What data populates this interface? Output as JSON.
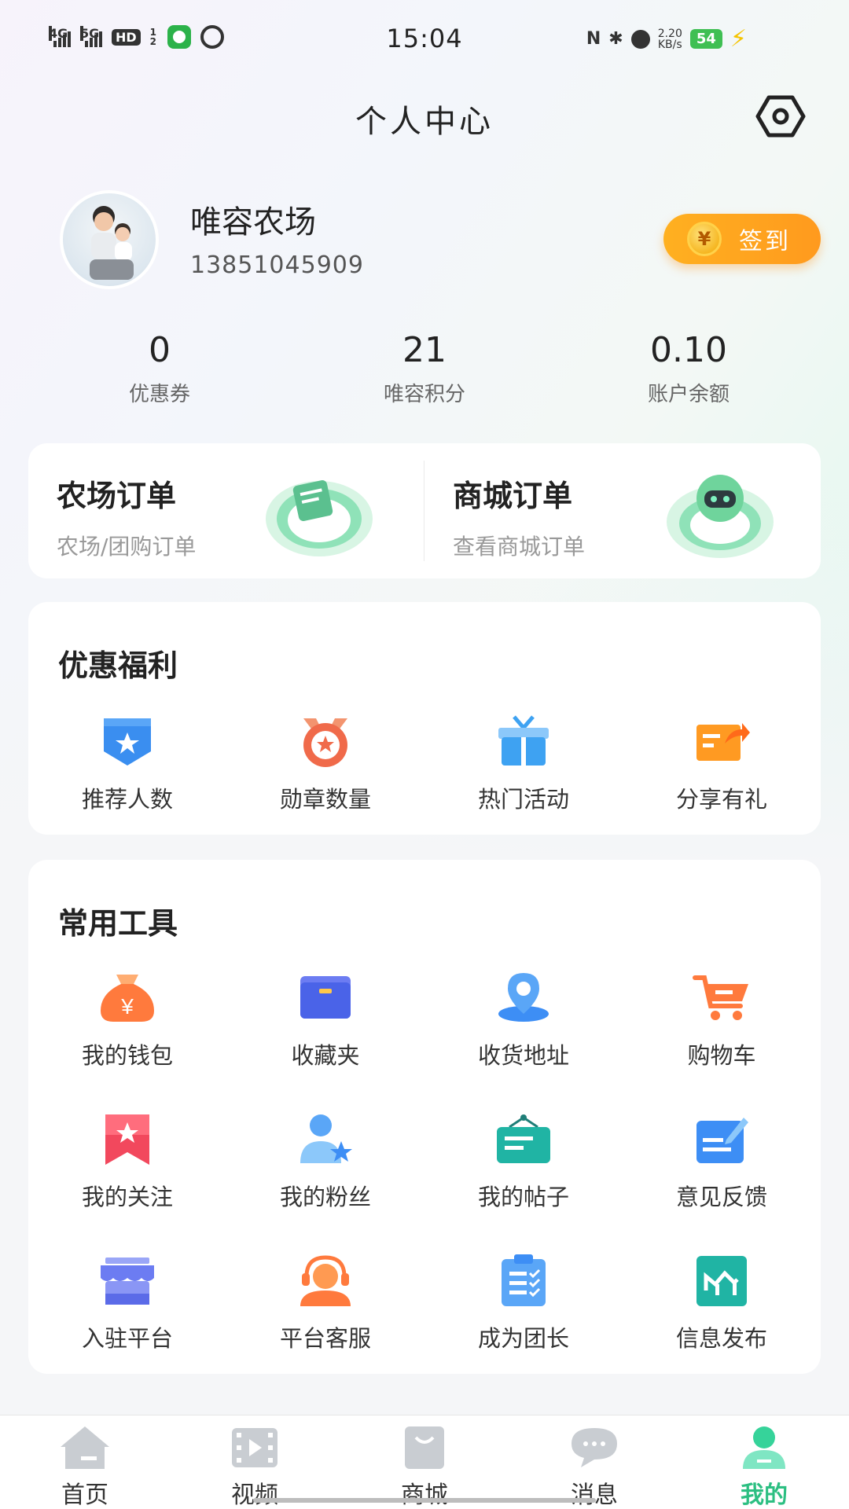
{
  "status_bar": {
    "signal_1": "4G",
    "signal_2": "5G",
    "hd": "HD",
    "hd_sub": "1 2",
    "time": "15:04",
    "speed_value": "2.20",
    "speed_unit": "KB/s",
    "battery": "54"
  },
  "header": {
    "title": "个人中心"
  },
  "profile": {
    "name": "唯容农场",
    "phone": "13851045909",
    "checkin_label": "签到",
    "checkin_coin": "¥"
  },
  "stats": [
    {
      "value": "0",
      "label": "优惠券"
    },
    {
      "value": "21",
      "label": "唯容积分"
    },
    {
      "value": "0.10",
      "label": "账户余额"
    }
  ],
  "orders": [
    {
      "title": "农场订单",
      "subtitle": "农场/团购订单"
    },
    {
      "title": "商城订单",
      "subtitle": "查看商城订单"
    }
  ],
  "benefits": {
    "title": "优惠福利",
    "items": [
      {
        "label": "推荐人数",
        "icon": "shield-star-icon",
        "color": "#3a8ef0"
      },
      {
        "label": "勋章数量",
        "icon": "medal-icon",
        "color": "#f06a4a"
      },
      {
        "label": "热门活动",
        "icon": "gift-icon",
        "color": "#3ea2f2"
      },
      {
        "label": "分享有礼",
        "icon": "share-icon",
        "color": "#ff9a22"
      }
    ]
  },
  "tools": {
    "title": "常用工具",
    "items": [
      {
        "label": "我的钱包",
        "icon": "wallet-bag-icon"
      },
      {
        "label": "收藏夹",
        "icon": "folder-icon"
      },
      {
        "label": "收货地址",
        "icon": "location-pin-icon"
      },
      {
        "label": "购物车",
        "icon": "cart-icon"
      },
      {
        "label": "我的关注",
        "icon": "bookmark-star-icon"
      },
      {
        "label": "我的粉丝",
        "icon": "user-star-icon"
      },
      {
        "label": "我的帖子",
        "icon": "post-icon"
      },
      {
        "label": "意见反馈",
        "icon": "feedback-edit-icon"
      },
      {
        "label": "入驻平台",
        "icon": "store-icon"
      },
      {
        "label": "平台客服",
        "icon": "customer-service-icon"
      },
      {
        "label": "成为团长",
        "icon": "clipboard-list-icon"
      },
      {
        "label": "信息发布",
        "icon": "chart-board-icon"
      }
    ]
  },
  "tabbar": {
    "active": "我的",
    "accent": "#2cbf82",
    "items": [
      {
        "label": "首页",
        "icon": "home-icon"
      },
      {
        "label": "视频",
        "icon": "video-icon"
      },
      {
        "label": "商城",
        "icon": "shop-bag-icon"
      },
      {
        "label": "消息",
        "icon": "message-icon"
      },
      {
        "label": "我的",
        "icon": "profile-icon"
      }
    ]
  }
}
